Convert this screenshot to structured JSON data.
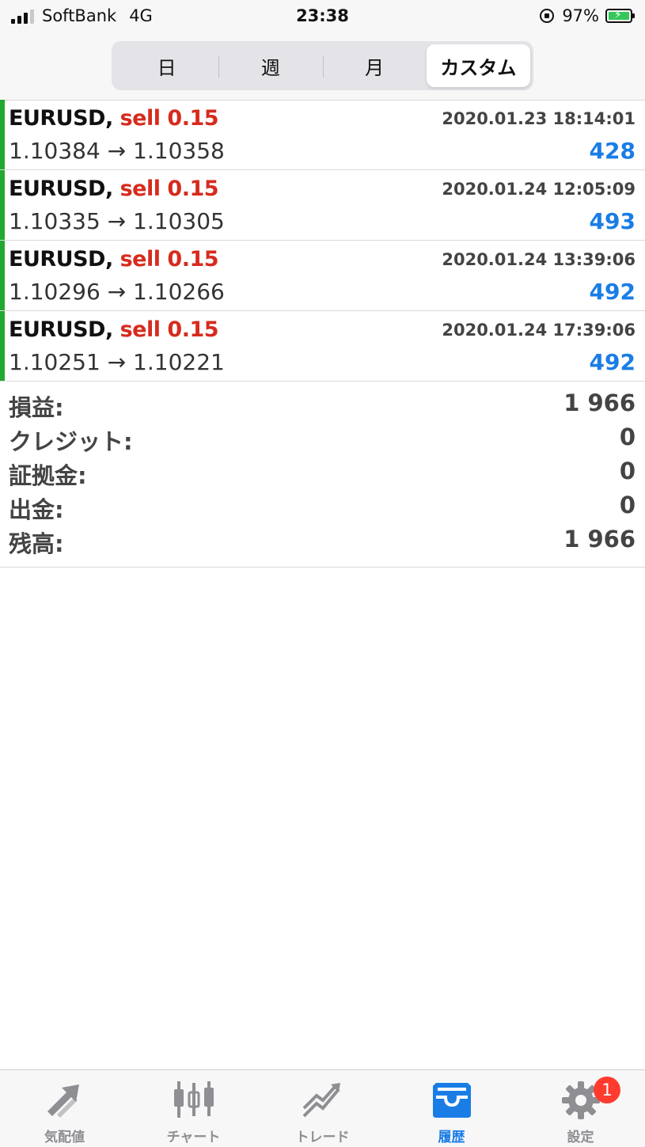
{
  "status_bar": {
    "carrier": "SoftBank",
    "network": "4G",
    "time": "23:38",
    "battery": "97%"
  },
  "period_tabs": [
    {
      "label": "日",
      "active": false
    },
    {
      "label": "週",
      "active": false
    },
    {
      "label": "月",
      "active": false
    },
    {
      "label": "カスタム",
      "active": true
    }
  ],
  "trades": [
    {
      "symbol": "EURUSD,",
      "side": "sell 0.15",
      "time": "2020.01.23 18:14:01",
      "prices": "1.10384 → 1.10358",
      "profit": "428"
    },
    {
      "symbol": "EURUSD,",
      "side": "sell 0.15",
      "time": "2020.01.24 12:05:09",
      "prices": "1.10335 → 1.10305",
      "profit": "493"
    },
    {
      "symbol": "EURUSD,",
      "side": "sell 0.15",
      "time": "2020.01.24 13:39:06",
      "prices": "1.10296 → 1.10266",
      "profit": "492"
    },
    {
      "symbol": "EURUSD,",
      "side": "sell 0.15",
      "time": "2020.01.24 17:39:06",
      "prices": "1.10251 → 1.10221",
      "profit": "492"
    }
  ],
  "summary": [
    {
      "label": "損益:",
      "value": "1 966"
    },
    {
      "label": "クレジット:",
      "value": "0"
    },
    {
      "label": "証拠金:",
      "value": "0"
    },
    {
      "label": "出金:",
      "value": "0"
    },
    {
      "label": "残高:",
      "value": "1 966"
    }
  ],
  "tab_bar": [
    {
      "label": "気配値",
      "icon": "quotes-icon",
      "active": false
    },
    {
      "label": "チャート",
      "icon": "chart-icon",
      "active": false
    },
    {
      "label": "トレード",
      "icon": "trade-icon",
      "active": false
    },
    {
      "label": "履歴",
      "icon": "history-icon",
      "active": true
    },
    {
      "label": "設定",
      "icon": "settings-icon",
      "active": false,
      "badge": "1"
    }
  ],
  "colors": {
    "profit_blue": "#1a7de6",
    "sell_red": "#d62b1e",
    "row_accent_green": "#22a92f",
    "badge_red": "#ff3b30"
  }
}
